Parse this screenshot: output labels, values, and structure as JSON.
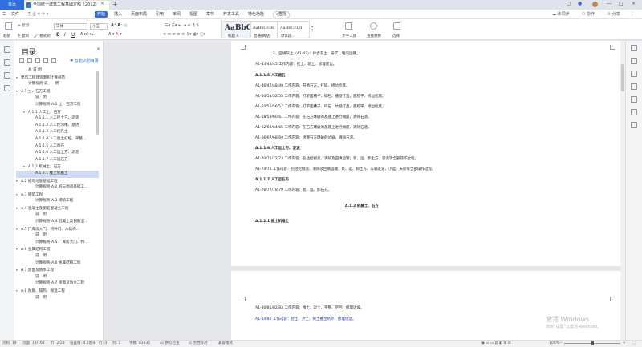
{
  "tabs": {
    "home": "首页",
    "document": "全国统一建筑工程基础定额（2012）"
  },
  "window": {
    "minimize": "—",
    "maximize": "□",
    "close": "×"
  },
  "menu": [
    "文件",
    "开始",
    "插入",
    "页面布局",
    "引用",
    "审阅",
    "视图",
    "章节",
    "开发工具",
    "特色功能",
    "查找"
  ],
  "menu_right": {
    "sync": "未同步",
    "collab": "协作",
    "share": "分享"
  },
  "toolbar": {
    "paste": "粘贴",
    "cut": "剪切",
    "copy": "复制",
    "format_painter": "格式刷",
    "font": "宋体",
    "size": "小五",
    "styles": [
      {
        "preview": "AaBbC",
        "label": "标题 4"
      },
      {
        "preview": "AaBbCcDd",
        "label": "普通(网站)"
      },
      {
        "preview": "AaBbCcDd",
        "label": "默认段..."
      }
    ],
    "text_tools": "文字工具",
    "find_replace": "查找替换",
    "select": "选择"
  },
  "nav": {
    "title": "目录",
    "smart": "智能识别目录",
    "items": [
      {
        "text": "总 说 明",
        "level": 1,
        "arrow": ""
      },
      {
        "text": "建筑工程建筑面积计算规范",
        "level": 0,
        "arrow": "▾"
      },
      {
        "text": "计算规则-说　　明",
        "level": 1,
        "arrow": ""
      },
      {
        "text": "A.1 土、石方工程",
        "level": 0,
        "arrow": "▾"
      },
      {
        "text": "说　明",
        "level": 2,
        "arrow": ""
      },
      {
        "text": "计算规则-A.1 土、石方工程",
        "level": 2,
        "arrow": ""
      },
      {
        "text": "A.1.1 人工土、石方",
        "level": 1,
        "arrow": "▾"
      },
      {
        "text": "A.1.1.1 人工挖土方、淤泥",
        "level": 2,
        "arrow": ""
      },
      {
        "text": "A.1.1.2 人工挖沟槽、基坑",
        "level": 2,
        "arrow": ""
      },
      {
        "text": "A.1.1.3 人工挖孔土",
        "level": 2,
        "arrow": ""
      },
      {
        "text": "A.1.1.4 人工凿土打桩、平整...",
        "level": 2,
        "arrow": ""
      },
      {
        "text": "A.1.1.5 人工凿石",
        "level": 2,
        "arrow": ""
      },
      {
        "text": "A.1.1.6 人工运土方、淤泥",
        "level": 2,
        "arrow": ""
      },
      {
        "text": "A.1.1.7 人工运石方",
        "level": 2,
        "arrow": ""
      },
      {
        "text": "A.1.2 机械土、石方",
        "level": 1,
        "arrow": "▾"
      },
      {
        "text": "A.1.2.1 推土机推土",
        "level": 2,
        "arrow": "",
        "selected": true
      },
      {
        "text": "A.2 桩与地基基础工程",
        "level": 0,
        "arrow": "▾"
      },
      {
        "text": "计算规则-A.2 桩与地基基础工...",
        "level": 2,
        "arrow": ""
      },
      {
        "text": "A.3 砌筑工程",
        "level": 0,
        "arrow": "▾"
      },
      {
        "text": "计算规则-A.3 砌筑工程",
        "level": 2,
        "arrow": ""
      },
      {
        "text": "A.4 混凝土及钢筋混凝土工程",
        "level": 0,
        "arrow": "▾"
      },
      {
        "text": "说　明",
        "level": 2,
        "arrow": ""
      },
      {
        "text": "计算规则-A.4 混凝土及钢筋混...",
        "level": 2,
        "arrow": ""
      },
      {
        "text": "A.5 厂库房大门、特种门、木结构...",
        "level": 0,
        "arrow": "▾"
      },
      {
        "text": "说　明",
        "level": 2,
        "arrow": ""
      },
      {
        "text": "计算规则-A.5 厂库房大门、特...",
        "level": 2,
        "arrow": ""
      },
      {
        "text": "A.6 金属结构工程",
        "level": 0,
        "arrow": "▾"
      },
      {
        "text": "说　明",
        "level": 2,
        "arrow": ""
      },
      {
        "text": "计算规则-A.6 金属结构工程",
        "level": 2,
        "arrow": ""
      },
      {
        "text": "A.7 屋面及防水工程",
        "level": 0,
        "arrow": "▾"
      },
      {
        "text": "说　明",
        "level": 2,
        "arrow": ""
      },
      {
        "text": "计算规则-A.7 屋面及防水工程",
        "level": 2,
        "arrow": ""
      },
      {
        "text": "A.8 防腐、隔热、保温工程",
        "level": 0,
        "arrow": "▾"
      },
      {
        "text": "说　明",
        "level": 2,
        "arrow": ""
      }
    ]
  },
  "page1": [
    {
      "text": "2、回填灰土（A1-42）：拌合灰土、夯实、场内运输。",
      "style": "n",
      "indent": 1
    },
    {
      "text": "A1-43/44/45 工作内容：挖土、装土、修理底边。",
      "style": "n",
      "indent": 0
    },
    {
      "text": "A.1.1.5 人工凿石",
      "style": "b",
      "indent": 0
    },
    {
      "text": "A1-46/47/48/49 工作内容：开凿石方、打碎、修边检底。",
      "style": "n",
      "indent": 0
    },
    {
      "text": "A1-50/51/52/53 工作内容：打单面槽子、碎石、槽壁打直、底检平、修边检底。",
      "style": "n",
      "indent": 0
    },
    {
      "text": "A1-54/55/56/57 工作内容：打单面槽子、碎石、坑壁打直、底检平、修边检底。",
      "style": "n",
      "indent": 0
    },
    {
      "text": "A1-58/59/60/61 工作内容：在石方爆破的基底上进行摊座，清除石渣。",
      "style": "n",
      "indent": 0
    },
    {
      "text": "A1-62/63/64/65 工作内容：在石方爆破的基底上进行摊座，清除石渣。",
      "style": "n",
      "indent": 0
    },
    {
      "text": "A1-66/67/68/69 工作内容：修整石方爆破的边坡，清除石渣。",
      "style": "n",
      "indent": 0
    },
    {
      "text": "A.1.1.6 人工运土方、淤泥",
      "style": "b",
      "indent": 0
    },
    {
      "text": "A1-70/71/72/73 工作内容：包括挖掘泥、清除及回填运输；装、运、卸土方、淤泥等全部操作过程。",
      "style": "n",
      "indent": 0
    },
    {
      "text": "A1-74/75 工作内容：包括挖掘泥、清除及回填运输；装、运、卸土方、车辆走道、小运、夫职等全部操作过程。",
      "style": "n",
      "indent": 0
    },
    {
      "text": "A.1.1.7 人工运石方",
      "style": "b",
      "indent": 0
    },
    {
      "text": "A1-76/77/78/79 工作内容：装、运、卸石方。",
      "style": "n",
      "indent": 0
    },
    {
      "text": "A.1.2 机械土、石方",
      "style": "b",
      "indent": 2
    },
    {
      "text": "A.1.2.1 推土机推土",
      "style": "b",
      "indent": 0
    }
  ],
  "page2": [
    {
      "text": "A1-80/81/82/83 工作内容：推土、运土、平整、空回、修理边坡。",
      "style": "n"
    },
    {
      "text": "A1-84/85 工作内容：挖土、弃土、将土推至坑外、修理坑边。",
      "style": "blue"
    }
  ],
  "status": {
    "page": "页码: 19",
    "pages": "页面: 19/162",
    "section": "节: 2/23",
    "setting": "设置值: 4.1厘米",
    "row": "行: 3",
    "col": "列: 1",
    "words": "字数: 63335",
    "spell": "拼写检查",
    "doc_check": "文档校对",
    "compat": "兼容模式",
    "zoom": "100%"
  },
  "watermark": {
    "title": "激活 Windows",
    "sub": "转到“设置”以激活 Windows。"
  }
}
